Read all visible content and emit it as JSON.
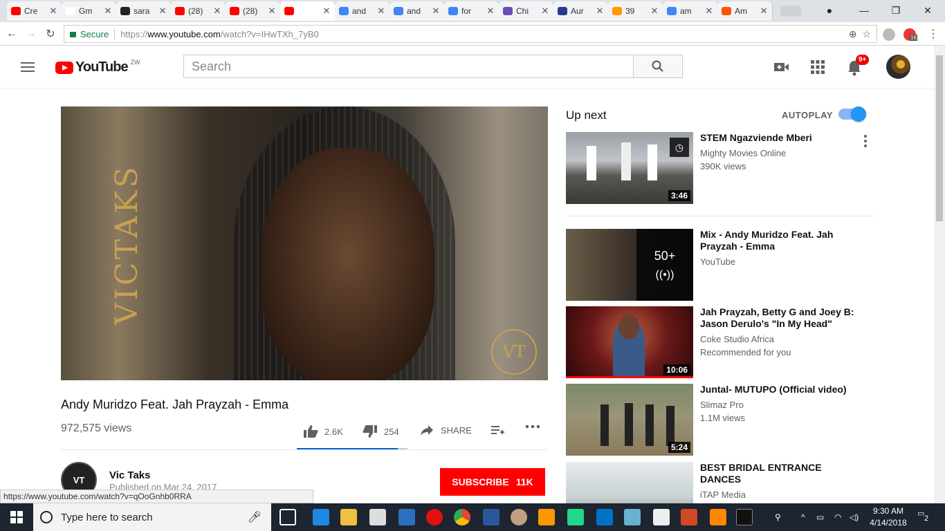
{
  "browser": {
    "tabs": [
      {
        "title": "Cre",
        "fav": "#ff0000",
        "icon": "youtube-icon"
      },
      {
        "title": "Gm",
        "fav": "#ffffff",
        "icon": "gmail-icon"
      },
      {
        "title": "sara",
        "fav": "#222222",
        "icon": "github-icon"
      },
      {
        "title": "(28)",
        "fav": "#ff0000",
        "icon": "youtube-icon"
      },
      {
        "title": "(28)",
        "fav": "#ff0000",
        "icon": "youtube-icon"
      },
      {
        "title": "",
        "fav": "#ff0000",
        "icon": "youtube-icon",
        "active": true
      },
      {
        "title": "and",
        "fav": "#4285f4",
        "icon": "google-icon"
      },
      {
        "title": "and",
        "fav": "#4285f4",
        "icon": "google-icon"
      },
      {
        "title": "for",
        "fav": "#4285f4",
        "icon": "google-icon"
      },
      {
        "title": "Chi",
        "fav": "#6a4fb8",
        "icon": "guitar-icon"
      },
      {
        "title": "Aur",
        "fav": "#2a3a8a",
        "icon": "s-icon"
      },
      {
        "title": "39",
        "fav": "#ff9900",
        "icon": "her-icon"
      },
      {
        "title": "am",
        "fav": "#4285f4",
        "icon": "google-icon"
      },
      {
        "title": "Am",
        "fav": "#ff5500",
        "icon": "fire-icon"
      }
    ],
    "secure_label": "Secure",
    "url_prefix": "https://",
    "url_host": "www.youtube.com",
    "url_path": "/watch?v=IHwTXh_7yB0",
    "ext_badge": "16"
  },
  "header": {
    "logo_text": "YouTube",
    "region": "ZW",
    "search_placeholder": "Search",
    "notif_count": "9+"
  },
  "video": {
    "title": "Andy Muridzo Feat. Jah Prayzah - Emma",
    "views": "972,575 views",
    "likes": "2.6K",
    "dislikes": "254",
    "share_label": "SHARE",
    "like_ratio": 0.91,
    "brand_text": "VICTAKS",
    "brand_mark": "VT"
  },
  "channel": {
    "name": "Vic Taks",
    "published": "Published on Mar 24, 2017",
    "avatar_text": "VT",
    "subscribe_label": "SUBSCRIBE",
    "subscriber_count": "11K"
  },
  "sidebar": {
    "up_next": "Up next",
    "autoplay": "AUTOPLAY",
    "recs": [
      {
        "title": "STEM Ngazviende Mberi",
        "channel": "Mighty Movies Online",
        "meta": "390K views",
        "duration": "3:46"
      },
      {
        "title": "Mix - Andy Muridzo Feat. Jah Prayzah - Emma",
        "channel": "YouTube",
        "meta": "",
        "count": "50+"
      },
      {
        "title": "Jah Prayzah, Betty G and Joey B: Jason Derulo's \"In My Head\"",
        "channel": "Coke Studio Africa",
        "meta": "Recommended for you",
        "duration": "10:06"
      },
      {
        "title": "Juntal- MUTUPO (Official video)",
        "channel": "Slimaz Pro",
        "meta": "1.1M views",
        "duration": "5:24"
      },
      {
        "title": "BEST BRIDAL ENTRANCE DANCES",
        "channel": "iTAP Media",
        "meta": "",
        "duration": ""
      }
    ]
  },
  "status_url": "https://www.youtube.com/watch?v=qOoGnhb0RRA",
  "taskbar": {
    "search_placeholder": "Type here to search",
    "time": "9:30 AM",
    "date": "4/14/2018",
    "notif_count": "2"
  }
}
